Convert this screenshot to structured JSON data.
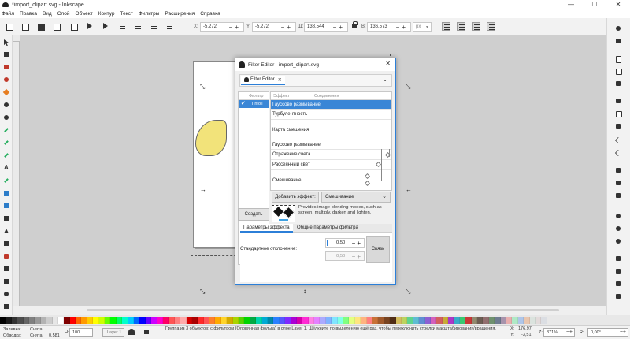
{
  "window": {
    "title": "*import_clipart.svg - Inkscape",
    "minimize": "—",
    "maximize": "☐",
    "close": "✕"
  },
  "menu": [
    "Файл",
    "Правка",
    "Вид",
    "Слой",
    "Объект",
    "Контур",
    "Текст",
    "Фильтры",
    "Расширения",
    "Справка"
  ],
  "toolbar": {
    "x_label": "X:",
    "x_value": "-5,272",
    "y_label": "Y:",
    "y_value": "-5,272",
    "w_label": "Ш:",
    "w_value": "138,544",
    "h_label": "В:",
    "h_value": "136,573",
    "unit": "px"
  },
  "filter_editor": {
    "title": "Filter Editor - import_clipart.svg",
    "tab_label": "Filter Editor",
    "filters_header": "Фильтр",
    "filter_name": "Tinfoil",
    "effects_header": "Эффект",
    "connections_header": "Соединения",
    "effects": [
      "Гауссово размывание",
      "Турбулентность",
      "Карта смещения",
      "Гауссово размывание",
      "Отражение света",
      "Рассеянный свет",
      "Смешивание"
    ],
    "create_button": "Создать",
    "add_effect_button": "Добавить эффект:",
    "add_effect_select": "Смешивание",
    "description": "Provides image blending modes, such as screen, multiply, darken and lighten.",
    "tab_effect_params": "Параметры эффекта",
    "tab_filter_params": "Общие параметры фильтра",
    "std_dev_label": "Стандартное отклонение:",
    "std_dev_x": "0,50",
    "std_dev_y": "0,50",
    "link_button": "Связь"
  },
  "status": {
    "fill_label": "Заливка:",
    "fill_value": "Снята",
    "stroke_label": "Обводка:",
    "stroke_value": "Снята",
    "stroke_width": "0,581",
    "opacity_label": "Н:",
    "opacity_value": "100",
    "layer": "Layer 1",
    "message": "Группа из 3 объектов; с фильтром (Оловянная фольга) в слое Layer 1. Щёлкните по выделению ещё раз, чтобы переключить стрелки масштабирования/вращения.",
    "x_label": "X:",
    "x_value": "176,97",
    "y_label": "Y:",
    "y_value": "-3,51",
    "zoom_label": "Z:",
    "zoom_value": "371%",
    "rot_label": "R:",
    "rot_value": "0,00°"
  },
  "palette_colors": [
    "#000000",
    "#1a1a1a",
    "#333333",
    "#4d4d4d",
    "#666666",
    "#808080",
    "#999999",
    "#b3b3b3",
    "#cccccc",
    "#e6e6e6",
    "#ffffff",
    "#800000",
    "#ff0000",
    "#ff6600",
    "#ff9900",
    "#ffcc00",
    "#ffff00",
    "#ccff00",
    "#66ff00",
    "#00ff00",
    "#00ff66",
    "#00ffcc",
    "#00ccff",
    "#0066ff",
    "#0000ff",
    "#6600ff",
    "#cc00ff",
    "#ff00cc",
    "#ff0066",
    "#ff5555",
    "#ff8080",
    "#ffaaaa",
    "#d40000",
    "#aa0000",
    "#ff2a2a",
    "#ff5555",
    "#ff7f2a",
    "#ffaa00",
    "#ffd42a",
    "#d4aa00",
    "#aad400",
    "#55d400",
    "#00d400",
    "#00aa44",
    "#00d4aa",
    "#00aad4",
    "#0088aa",
    "#2a7fff",
    "#5555ff",
    "#7f2aff",
    "#aa00d4",
    "#d400aa",
    "#ff2ad4",
    "#ff80e5",
    "#e580ff",
    "#aaaaff",
    "#80b3ff",
    "#80e5ff",
    "#80ffe5",
    "#80ff80",
    "#e5ff80",
    "#ffe680",
    "#ffb380",
    "#ff8080",
    "#c87137",
    "#a05a2c",
    "#784421",
    "#502d16",
    "#d3bc5f",
    "#bcd35f",
    "#5fd38d",
    "#5fbcd3",
    "#5f8dd3",
    "#8d5fd3",
    "#d35fbc",
    "#d35f5f",
    "#c8ab37",
    "#ab37c8",
    "#37abc8",
    "#37c871",
    "#c83737",
    "#918a6f",
    "#6c5d53",
    "#916f6f",
    "#6f916f",
    "#6f7c91",
    "#a793ac",
    "#e9afaf",
    "#afe9c6",
    "#afc6e9",
    "#e9c6af",
    "#dbe3de",
    "#e3dbdb",
    "#dbdee3"
  ],
  "icons": {
    "app": "inkscape-icon",
    "dialog": "inkscape-icon"
  }
}
